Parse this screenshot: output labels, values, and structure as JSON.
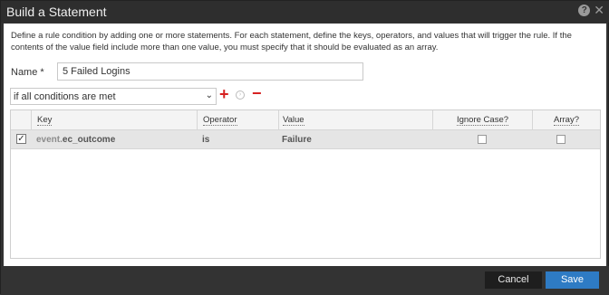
{
  "dialog": {
    "title": "Build a Statement"
  },
  "description": "Define a rule condition by adding one or more statements. For each statement, define the keys, operators, and values that will trigger the rule. If the contents of the value field include more than one value, you must specify that it should be evaluated as an array.",
  "name_field": {
    "label": "Name *",
    "value": "5 Failed Logins"
  },
  "condition": {
    "selected": "if all conditions are met"
  },
  "icons": {
    "help": "help-icon",
    "close": "close-icon",
    "add": "plus-icon",
    "info": "info-icon",
    "remove": "minus-icon"
  },
  "table": {
    "columns": {
      "key": "Key",
      "operator": "Operator",
      "value": "Value",
      "ignore_case": "Ignore Case?",
      "array": "Array?"
    },
    "rows": [
      {
        "checked": true,
        "key_prefix": "event.",
        "key_main": "ec_outcome",
        "operator": "is",
        "value": "Failure",
        "ignore_case": false,
        "array": false
      }
    ]
  },
  "footer": {
    "cancel_label": "Cancel",
    "save_label": "Save"
  },
  "colors": {
    "accent": "#2e7bc4",
    "danger": "#d62020",
    "chrome": "#333333"
  }
}
